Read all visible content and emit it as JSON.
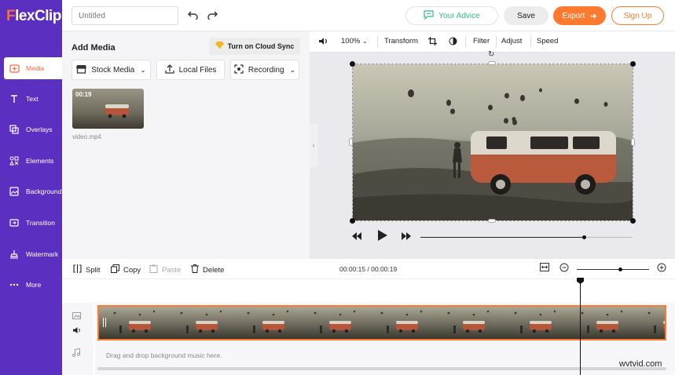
{
  "app": {
    "logo_f": "F",
    "logo_rest": "lexClip"
  },
  "sidebar": {
    "items": [
      {
        "label": "Media",
        "icon": "media-icon"
      },
      {
        "label": "Text",
        "icon": "text-icon"
      },
      {
        "label": "Overlays",
        "icon": "overlays-icon"
      },
      {
        "label": "Elements",
        "icon": "elements-icon"
      },
      {
        "label": "Background",
        "icon": "background-icon"
      },
      {
        "label": "Transition",
        "icon": "transition-icon"
      },
      {
        "label": "Watermark",
        "icon": "watermark-icon"
      },
      {
        "label": "More",
        "icon": "more-icon"
      }
    ]
  },
  "topbar": {
    "title_placeholder": "Untitled",
    "advice_label": "Your Advice",
    "save_label": "Save",
    "export_label": "Export",
    "signup_label": "Sign Up"
  },
  "media": {
    "heading": "Add Media",
    "cloud_sync_label": "Turn on Cloud Sync",
    "stock_label": "Stock Media",
    "local_label": "Local Files",
    "recording_label": "Recording",
    "clip": {
      "duration": "00:19",
      "filename": "video.mp4"
    }
  },
  "preview": {
    "zoom": "100%",
    "transform_label": "Transform",
    "filter_label": "Filter",
    "adjust_label": "Adjust",
    "speed_label": "Speed",
    "progress": 0.77
  },
  "timeline": {
    "split_label": "Split",
    "copy_label": "Copy",
    "paste_label": "Paste",
    "delete_label": "Delete",
    "time": "00:00:15 / 00:00:19",
    "zoom_level": 0.6,
    "music_hint": "Drag and drop background music here."
  },
  "watermark_text": "wvtvid.com",
  "colors": {
    "sidebar": "#5b2fc0",
    "accent": "#ff7a2f",
    "advice": "#2fbf88"
  }
}
